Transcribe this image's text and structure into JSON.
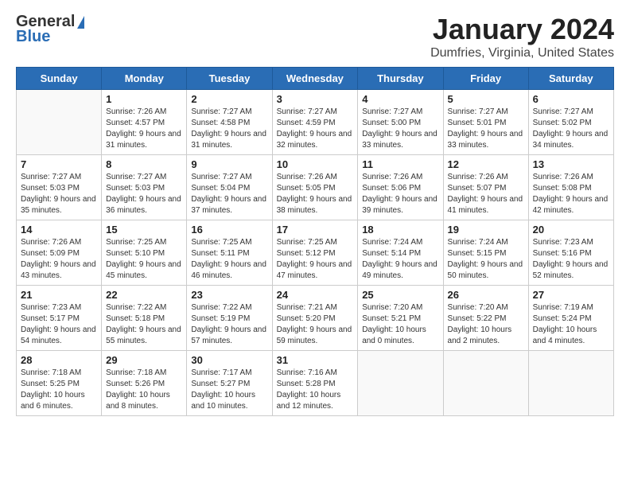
{
  "header": {
    "logo_general": "General",
    "logo_blue": "Blue",
    "month": "January 2024",
    "location": "Dumfries, Virginia, United States"
  },
  "weekdays": [
    "Sunday",
    "Monday",
    "Tuesday",
    "Wednesday",
    "Thursday",
    "Friday",
    "Saturday"
  ],
  "weeks": [
    [
      {
        "day": "",
        "sunrise": "",
        "sunset": "",
        "daylight": ""
      },
      {
        "day": "1",
        "sunrise": "Sunrise: 7:26 AM",
        "sunset": "Sunset: 4:57 PM",
        "daylight": "Daylight: 9 hours and 31 minutes."
      },
      {
        "day": "2",
        "sunrise": "Sunrise: 7:27 AM",
        "sunset": "Sunset: 4:58 PM",
        "daylight": "Daylight: 9 hours and 31 minutes."
      },
      {
        "day": "3",
        "sunrise": "Sunrise: 7:27 AM",
        "sunset": "Sunset: 4:59 PM",
        "daylight": "Daylight: 9 hours and 32 minutes."
      },
      {
        "day": "4",
        "sunrise": "Sunrise: 7:27 AM",
        "sunset": "Sunset: 5:00 PM",
        "daylight": "Daylight: 9 hours and 33 minutes."
      },
      {
        "day": "5",
        "sunrise": "Sunrise: 7:27 AM",
        "sunset": "Sunset: 5:01 PM",
        "daylight": "Daylight: 9 hours and 33 minutes."
      },
      {
        "day": "6",
        "sunrise": "Sunrise: 7:27 AM",
        "sunset": "Sunset: 5:02 PM",
        "daylight": "Daylight: 9 hours and 34 minutes."
      }
    ],
    [
      {
        "day": "7",
        "sunrise": "Sunrise: 7:27 AM",
        "sunset": "Sunset: 5:03 PM",
        "daylight": "Daylight: 9 hours and 35 minutes."
      },
      {
        "day": "8",
        "sunrise": "Sunrise: 7:27 AM",
        "sunset": "Sunset: 5:03 PM",
        "daylight": "Daylight: 9 hours and 36 minutes."
      },
      {
        "day": "9",
        "sunrise": "Sunrise: 7:27 AM",
        "sunset": "Sunset: 5:04 PM",
        "daylight": "Daylight: 9 hours and 37 minutes."
      },
      {
        "day": "10",
        "sunrise": "Sunrise: 7:26 AM",
        "sunset": "Sunset: 5:05 PM",
        "daylight": "Daylight: 9 hours and 38 minutes."
      },
      {
        "day": "11",
        "sunrise": "Sunrise: 7:26 AM",
        "sunset": "Sunset: 5:06 PM",
        "daylight": "Daylight: 9 hours and 39 minutes."
      },
      {
        "day": "12",
        "sunrise": "Sunrise: 7:26 AM",
        "sunset": "Sunset: 5:07 PM",
        "daylight": "Daylight: 9 hours and 41 minutes."
      },
      {
        "day": "13",
        "sunrise": "Sunrise: 7:26 AM",
        "sunset": "Sunset: 5:08 PM",
        "daylight": "Daylight: 9 hours and 42 minutes."
      }
    ],
    [
      {
        "day": "14",
        "sunrise": "Sunrise: 7:26 AM",
        "sunset": "Sunset: 5:09 PM",
        "daylight": "Daylight: 9 hours and 43 minutes."
      },
      {
        "day": "15",
        "sunrise": "Sunrise: 7:25 AM",
        "sunset": "Sunset: 5:10 PM",
        "daylight": "Daylight: 9 hours and 45 minutes."
      },
      {
        "day": "16",
        "sunrise": "Sunrise: 7:25 AM",
        "sunset": "Sunset: 5:11 PM",
        "daylight": "Daylight: 9 hours and 46 minutes."
      },
      {
        "day": "17",
        "sunrise": "Sunrise: 7:25 AM",
        "sunset": "Sunset: 5:12 PM",
        "daylight": "Daylight: 9 hours and 47 minutes."
      },
      {
        "day": "18",
        "sunrise": "Sunrise: 7:24 AM",
        "sunset": "Sunset: 5:14 PM",
        "daylight": "Daylight: 9 hours and 49 minutes."
      },
      {
        "day": "19",
        "sunrise": "Sunrise: 7:24 AM",
        "sunset": "Sunset: 5:15 PM",
        "daylight": "Daylight: 9 hours and 50 minutes."
      },
      {
        "day": "20",
        "sunrise": "Sunrise: 7:23 AM",
        "sunset": "Sunset: 5:16 PM",
        "daylight": "Daylight: 9 hours and 52 minutes."
      }
    ],
    [
      {
        "day": "21",
        "sunrise": "Sunrise: 7:23 AM",
        "sunset": "Sunset: 5:17 PM",
        "daylight": "Daylight: 9 hours and 54 minutes."
      },
      {
        "day": "22",
        "sunrise": "Sunrise: 7:22 AM",
        "sunset": "Sunset: 5:18 PM",
        "daylight": "Daylight: 9 hours and 55 minutes."
      },
      {
        "day": "23",
        "sunrise": "Sunrise: 7:22 AM",
        "sunset": "Sunset: 5:19 PM",
        "daylight": "Daylight: 9 hours and 57 minutes."
      },
      {
        "day": "24",
        "sunrise": "Sunrise: 7:21 AM",
        "sunset": "Sunset: 5:20 PM",
        "daylight": "Daylight: 9 hours and 59 minutes."
      },
      {
        "day": "25",
        "sunrise": "Sunrise: 7:20 AM",
        "sunset": "Sunset: 5:21 PM",
        "daylight": "Daylight: 10 hours and 0 minutes."
      },
      {
        "day": "26",
        "sunrise": "Sunrise: 7:20 AM",
        "sunset": "Sunset: 5:22 PM",
        "daylight": "Daylight: 10 hours and 2 minutes."
      },
      {
        "day": "27",
        "sunrise": "Sunrise: 7:19 AM",
        "sunset": "Sunset: 5:24 PM",
        "daylight": "Daylight: 10 hours and 4 minutes."
      }
    ],
    [
      {
        "day": "28",
        "sunrise": "Sunrise: 7:18 AM",
        "sunset": "Sunset: 5:25 PM",
        "daylight": "Daylight: 10 hours and 6 minutes."
      },
      {
        "day": "29",
        "sunrise": "Sunrise: 7:18 AM",
        "sunset": "Sunset: 5:26 PM",
        "daylight": "Daylight: 10 hours and 8 minutes."
      },
      {
        "day": "30",
        "sunrise": "Sunrise: 7:17 AM",
        "sunset": "Sunset: 5:27 PM",
        "daylight": "Daylight: 10 hours and 10 minutes."
      },
      {
        "day": "31",
        "sunrise": "Sunrise: 7:16 AM",
        "sunset": "Sunset: 5:28 PM",
        "daylight": "Daylight: 10 hours and 12 minutes."
      },
      {
        "day": "",
        "sunrise": "",
        "sunset": "",
        "daylight": ""
      },
      {
        "day": "",
        "sunrise": "",
        "sunset": "",
        "daylight": ""
      },
      {
        "day": "",
        "sunrise": "",
        "sunset": "",
        "daylight": ""
      }
    ]
  ]
}
